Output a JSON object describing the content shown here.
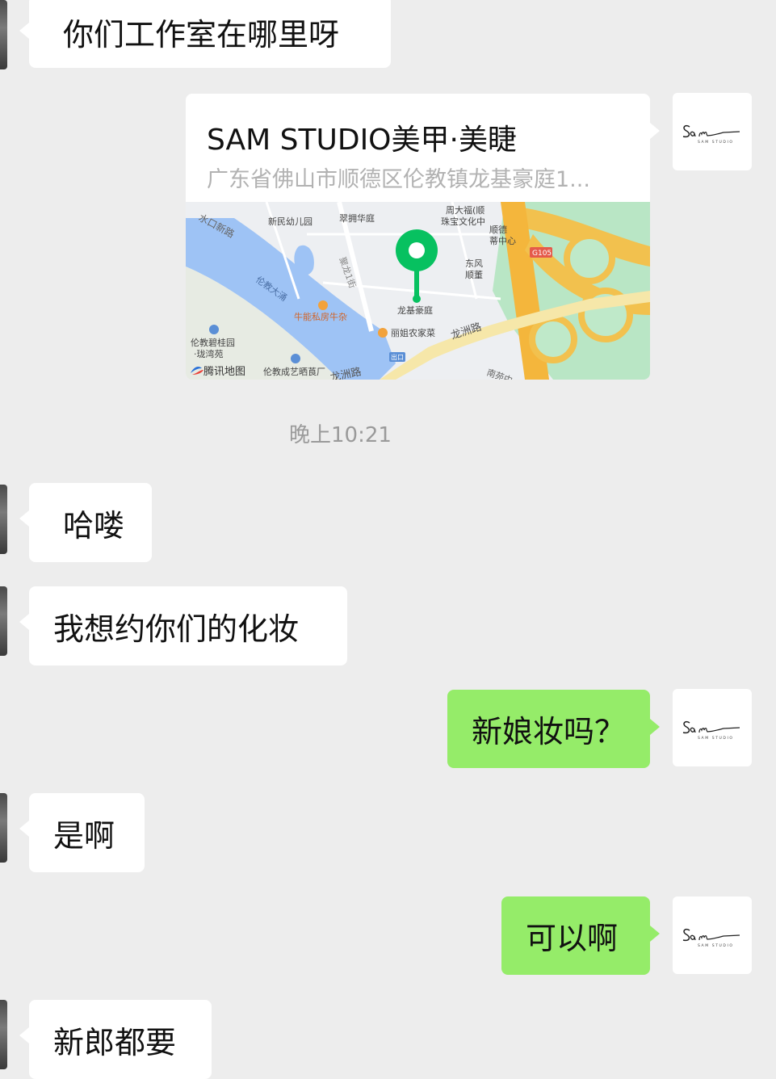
{
  "colors": {
    "background": "#ededed",
    "bubble_in": "#ffffff",
    "bubble_out": "#95ec69",
    "map_pin": "#07c160"
  },
  "messages": [
    {
      "from": "them",
      "text": "你们工作室在哪里呀"
    },
    {
      "from": "me",
      "type": "location",
      "title": "SAM STUDIO美甲·美睫",
      "address": "广东省佛山市顺德区伦教镇龙基豪庭1..."
    },
    {
      "from": "them",
      "text": "哈喽"
    },
    {
      "from": "them",
      "text": "我想约你们的化妆"
    },
    {
      "from": "me",
      "text": "新娘妆吗？"
    },
    {
      "from": "them",
      "text": "是啊"
    },
    {
      "from": "me",
      "text": "可以啊"
    },
    {
      "from": "them",
      "text": "新郎都要"
    }
  ],
  "timestamp": "晚上10:21",
  "avatar": {
    "brand_script": "Sam",
    "brand_sub": "SAM STUDIO",
    "icon": "sam-studio-logo-icon"
  },
  "map": {
    "provider": "腾讯地图",
    "labels": {
      "water_road": "水口新路",
      "kindergarten": "新民幼儿园",
      "garden": "翠拥华庭",
      "jewelry": "周大福(顺",
      "jewelry2": "珠宝文化中",
      "shunde": "顺德",
      "center": "蒂中心",
      "highway": "G105",
      "dongfeng": "东风",
      "shunde2": "顺董",
      "river": "伦教大涌",
      "road1": "聚龙1街",
      "restaurant": "牛能私房牛杂",
      "poi": "龙基豪庭",
      "nong": "丽姐农家菜",
      "longzhou": "龙洲路",
      "biguiyuan": "伦教碧桂园",
      "longwan": "·珑湾苑",
      "exit": "出口",
      "chengyi": "伦教成艺晒莨厂",
      "longzhou2": "龙洲路",
      "nanyuan": "南苑中"
    }
  }
}
